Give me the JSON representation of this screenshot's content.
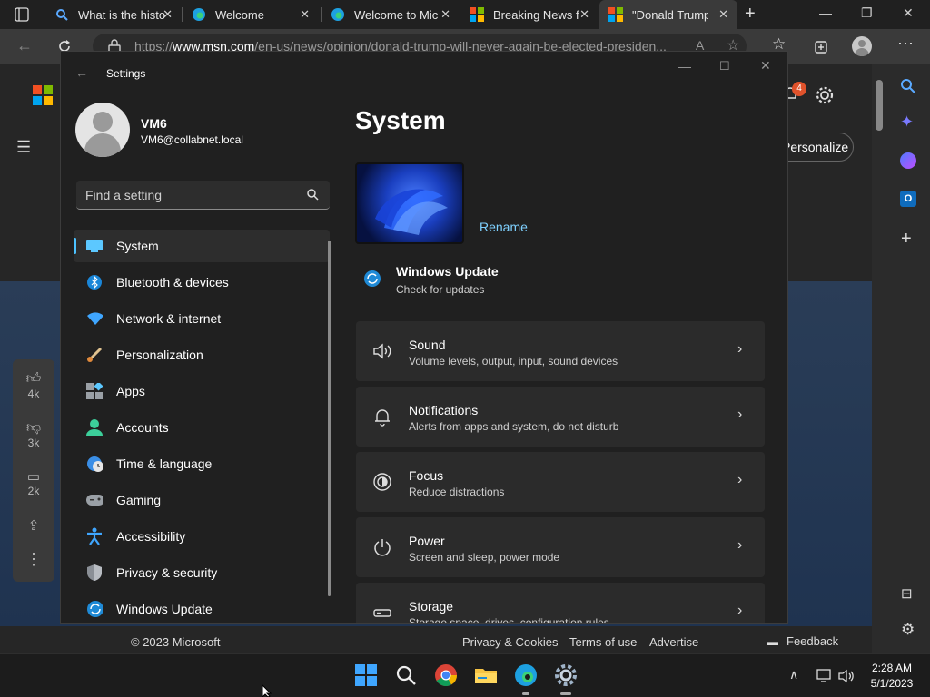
{
  "browser": {
    "tabs": [
      {
        "title": "What is the histo",
        "active": false
      },
      {
        "title": "Welcome",
        "active": false
      },
      {
        "title": "Welcome to Mic",
        "active": false
      },
      {
        "title": "Breaking News f",
        "active": false
      },
      {
        "title": "\"Donald Trump",
        "active": true
      }
    ],
    "url_prefix": "https://",
    "url_domain": "www.msn.com",
    "url_path": "/en-us/news/opinion/donald-trump-will-never-again-be-elected-presiden...",
    "notification_count": "4"
  },
  "msn": {
    "personalize_label": "Personalize",
    "reactions": [
      {
        "icon": "thumbs-up-icon",
        "count": "4k"
      },
      {
        "icon": "thumbs-down-icon",
        "count": "3k"
      },
      {
        "icon": "comment-icon",
        "count": "2k"
      }
    ],
    "footer": {
      "copyright": "© 2023 Microsoft",
      "links": [
        "Privacy & Cookies",
        "Terms of use",
        "Advertise"
      ],
      "feedback": "Feedback"
    }
  },
  "settings": {
    "window_title": "Settings",
    "user_name": "VM6",
    "user_email": "VM6@collabnet.local",
    "search_placeholder": "Find a setting",
    "nav": [
      {
        "label": "System",
        "icon": "system-icon",
        "selected": true
      },
      {
        "label": "Bluetooth & devices",
        "icon": "bluetooth-icon"
      },
      {
        "label": "Network & internet",
        "icon": "wifi-icon"
      },
      {
        "label": "Personalization",
        "icon": "brush-icon"
      },
      {
        "label": "Apps",
        "icon": "apps-icon"
      },
      {
        "label": "Accounts",
        "icon": "accounts-icon"
      },
      {
        "label": "Time & language",
        "icon": "clock-globe-icon"
      },
      {
        "label": "Gaming",
        "icon": "controller-icon"
      },
      {
        "label": "Accessibility",
        "icon": "accessibility-icon"
      },
      {
        "label": "Privacy & security",
        "icon": "shield-icon"
      },
      {
        "label": "Windows Update",
        "icon": "update-icon"
      }
    ],
    "page_title": "System",
    "rename_label": "Rename",
    "update": {
      "title": "Windows Update",
      "subtitle": "Check for updates"
    },
    "cards": [
      {
        "title": "Sound",
        "subtitle": "Volume levels, output, input, sound devices",
        "icon": "speaker-icon"
      },
      {
        "title": "Notifications",
        "subtitle": "Alerts from apps and system, do not disturb",
        "icon": "bell-icon"
      },
      {
        "title": "Focus",
        "subtitle": "Reduce distractions",
        "icon": "focus-icon"
      },
      {
        "title": "Power",
        "subtitle": "Screen and sleep, power mode",
        "icon": "power-icon"
      },
      {
        "title": "Storage",
        "subtitle": "Storage space, drives, configuration rules",
        "icon": "storage-icon"
      }
    ]
  },
  "taskbar": {
    "time": "2:28 AM",
    "date": "5/1/2023"
  },
  "colors": {
    "accent": "#4cc2ff",
    "settings_bg": "#202020",
    "card_bg": "#2b2b2b"
  }
}
